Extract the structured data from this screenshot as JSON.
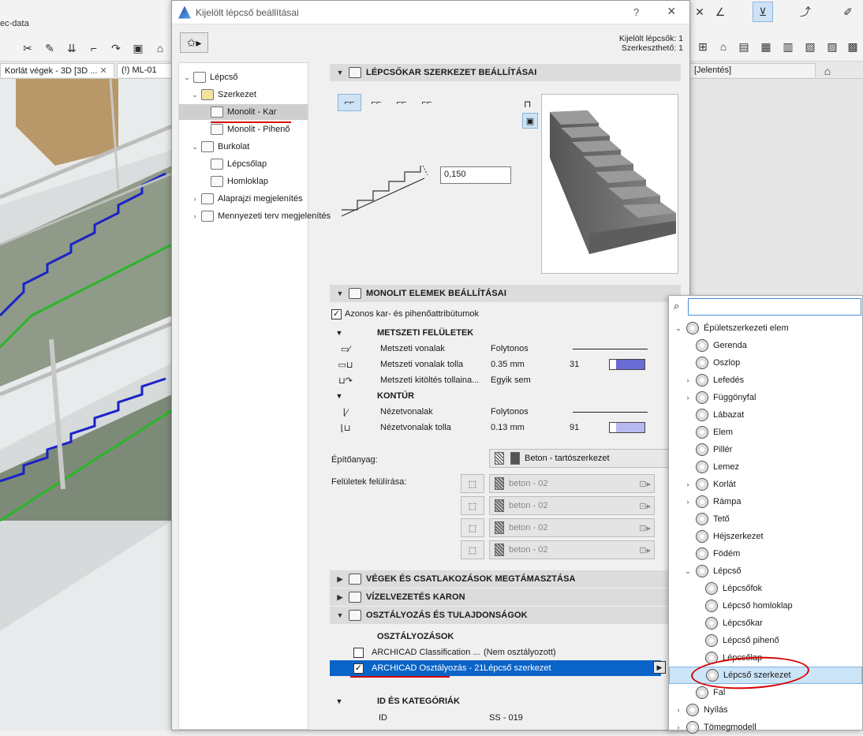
{
  "app": {
    "crumb_text": "ec-data",
    "tab_3d": "Korlát végek - 3D [3D ...",
    "tab_ml": "(!) ML-01",
    "report_text": "[Jelentés]"
  },
  "dialog": {
    "title": "Kijelölt lépcső beállításai",
    "help": "?",
    "close": "×",
    "selected_count": "Kijelölt lépcsők: 1",
    "editable_count": "Szerkeszthető: 1"
  },
  "tree": {
    "items": [
      {
        "label": "Lépcső",
        "level": 0
      },
      {
        "label": "Szerkezet",
        "level": 1
      },
      {
        "label": "Monolit - Kar",
        "level": 2
      },
      {
        "label": "Monolit - Pihenő",
        "level": 2
      },
      {
        "label": "Burkolat",
        "level": 1
      },
      {
        "label": "Lépcsőlap",
        "level": 2
      },
      {
        "label": "Homloklap",
        "level": 2
      },
      {
        "label": "Alaprajzi megjelenítés",
        "level": 1
      },
      {
        "label": "Mennyezeti terv megjelenítés",
        "level": 1
      }
    ]
  },
  "flight": {
    "header": "LÉPCSŐKAR SZERKEZET BEÁLLÍTÁSAI",
    "thickness_value": "0,150"
  },
  "monolit": {
    "header": "MONOLIT ELEMEK BEÁLLÍTÁSAI",
    "same_attr_label": "Azonos kar- és pihenőattribútumok",
    "section_cut": "METSZETI FELÜLETEK",
    "cut_rows": [
      {
        "label": "Metszeti vonalak",
        "value": "Folytonos",
        "num": ""
      },
      {
        "label": "Metszeti vonalak tolla",
        "value": "0.35 mm",
        "num": "31"
      },
      {
        "label": "Metszeti kitöltés tollaina...",
        "value": "Egyik sem",
        "num": ""
      }
    ],
    "section_contour": "KONTÚR",
    "contour_rows": [
      {
        "label": "Nézetvonalak",
        "value": "Folytonos",
        "num": ""
      },
      {
        "label": "Nézetvonalak tolla",
        "value": "0.13 mm",
        "num": "91"
      }
    ],
    "material_label": "Építőanyag:",
    "material_value": "Beton - tartószerkezet",
    "override_label": "Felületek felülírása:",
    "surfaces": [
      "beton - 02",
      "beton - 02",
      "beton - 02",
      "beton - 02"
    ]
  },
  "collapsed": {
    "ends": "VÉGEK ÉS CSATLAKOZÁSOK MEGTÁMASZTÁSA",
    "drain": "VÍZELVEZETÉS KARON",
    "classification": "OSZTÁLYOZÁS ÉS TULAJDONSÁGOK"
  },
  "classification": {
    "title": "OSZTÁLYOZÁSOK",
    "rows": [
      {
        "name": "ARCHICAD Classification ...",
        "value": "(Nem osztályozott)",
        "checked": false
      },
      {
        "name": "ARCHICAD Osztályozás - 21",
        "value": "Lépcső szerkezet",
        "checked": true
      }
    ],
    "id_header": "ID ÉS KATEGÓRIÁK",
    "id_label": "ID",
    "id_value": "SS - 019"
  },
  "popup": {
    "search_placeholder": "",
    "items": [
      {
        "label": "Épületszerkezeti elem",
        "indent": 0,
        "arrow": "down"
      },
      {
        "label": "Gerenda",
        "indent": 1,
        "arrow": ""
      },
      {
        "label": "Oszlop",
        "indent": 1,
        "arrow": ""
      },
      {
        "label": "Lefedés",
        "indent": 1,
        "arrow": "right"
      },
      {
        "label": "Függönyfal",
        "indent": 1,
        "arrow": "right"
      },
      {
        "label": "Lábazat",
        "indent": 1,
        "arrow": ""
      },
      {
        "label": "Elem",
        "indent": 1,
        "arrow": ""
      },
      {
        "label": "Pillér",
        "indent": 1,
        "arrow": ""
      },
      {
        "label": "Lemez",
        "indent": 1,
        "arrow": ""
      },
      {
        "label": "Korlát",
        "indent": 1,
        "arrow": "right"
      },
      {
        "label": "Rámpa",
        "indent": 1,
        "arrow": "right"
      },
      {
        "label": "Tető",
        "indent": 1,
        "arrow": ""
      },
      {
        "label": "Héjszerkezet",
        "indent": 1,
        "arrow": ""
      },
      {
        "label": "Födém",
        "indent": 1,
        "arrow": ""
      },
      {
        "label": "Lépcső",
        "indent": 1,
        "arrow": "down"
      },
      {
        "label": "Lépcsőfok",
        "indent": 2,
        "arrow": ""
      },
      {
        "label": "Lépcső homloklap",
        "indent": 2,
        "arrow": ""
      },
      {
        "label": "Lépcsőkar",
        "indent": 2,
        "arrow": ""
      },
      {
        "label": "Lépcső pihenő",
        "indent": 2,
        "arrow": ""
      },
      {
        "label": "Lépcsőlap",
        "indent": 2,
        "arrow": ""
      },
      {
        "label": "Lépcső szerkezet",
        "indent": 2,
        "arrow": "",
        "selected": true
      },
      {
        "label": "Fal",
        "indent": 1,
        "arrow": ""
      },
      {
        "label": "Nyílás",
        "indent": 0,
        "arrow": "right"
      },
      {
        "label": "Tömegmodell",
        "indent": 0,
        "arrow": "right"
      }
    ]
  },
  "colors": {
    "selection_blue": "#0a64c8",
    "highlight_light": "#cce4f7",
    "annotation_red": "#d40000",
    "pen_swatch": "#6b6bd6"
  }
}
